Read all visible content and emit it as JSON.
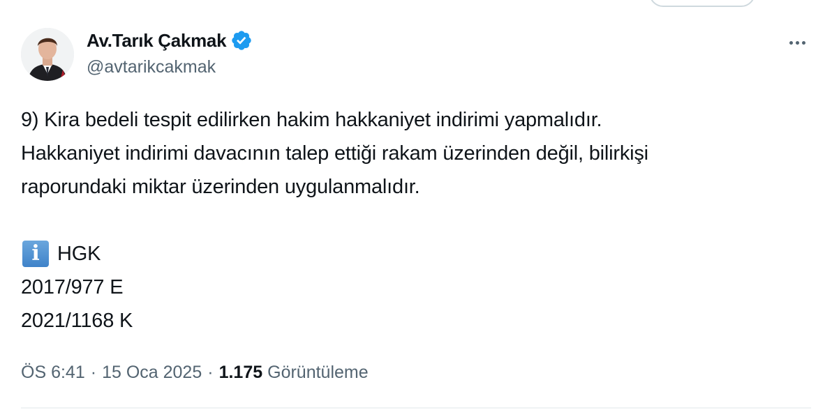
{
  "author": {
    "display_name": "Av.Tarık Çakmak",
    "handle": "@avtarikcakmak",
    "verified": true,
    "verified_color": "#1d9bf0"
  },
  "tweet": {
    "lines": [
      "9) Kira bedeli tespit edilirken hakim hakkaniyet indirimi yapmalıdır.",
      "Hakkaniyet indirimi davacının talep ettiği rakam üzerinden değil, bilirkişi",
      "raporundaki miktar üzerinden uygulanmalıdır."
    ],
    "info_emoji": "i",
    "court": "HGK",
    "case_number": "2017/977 E",
    "decision_number": "2021/1168 K"
  },
  "meta": {
    "time": "ÖS 6:41",
    "separator": "·",
    "date": "15 Oca 2025",
    "views_count": "1.175",
    "views_label": "Görüntüleme"
  },
  "icons": {
    "more": "more-horizontal-icon",
    "verified": "verified-badge-icon",
    "info": "information-icon"
  }
}
